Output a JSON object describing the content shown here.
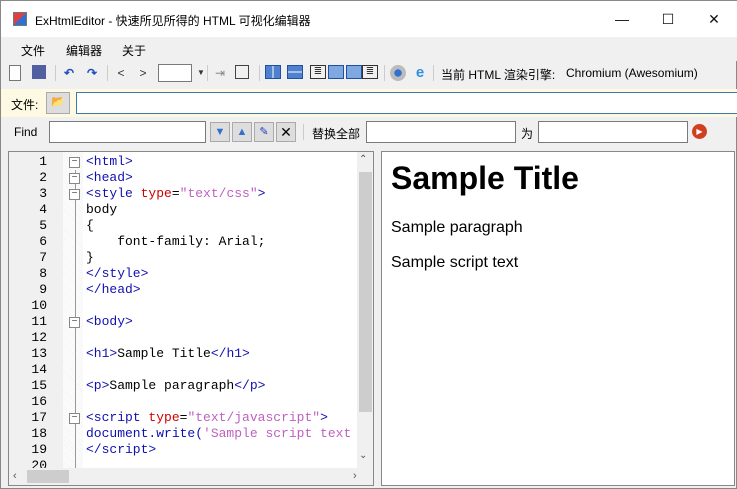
{
  "window": {
    "title": "ExHtmlEditor - 快速所见所得的 HTML 可视化编辑器",
    "minimize": "—",
    "maximize": "☐",
    "close": "✕"
  },
  "menu": [
    "文件",
    "编辑器",
    "关于"
  ],
  "toolbar": {
    "back": "<",
    "forward": ">",
    "zoom_value": "",
    "engine_label": "当前 HTML 渲染引擎:",
    "engine_value": "Chromium (Awesomium)"
  },
  "filebar": {
    "label": "文件:",
    "path": ""
  },
  "findbar": {
    "find_label": "Find",
    "find_value": "",
    "replace_all_label": "替换全部",
    "replace_from": "",
    "to_label": "为",
    "replace_to": ""
  },
  "editor": {
    "lines": [
      [
        [
          "t",
          "<html>"
        ]
      ],
      [
        [
          "t",
          "<head>"
        ]
      ],
      [
        [
          "t",
          "<style "
        ],
        [
          "a",
          "type"
        ],
        [
          "",
          "="
        ],
        [
          "s",
          "\"text/css\""
        ],
        [
          "t",
          ">"
        ]
      ],
      [
        [
          "",
          "body"
        ]
      ],
      [
        [
          "",
          "{"
        ]
      ],
      [
        [
          "",
          "    font-family: Arial;"
        ]
      ],
      [
        [
          "",
          "}"
        ]
      ],
      [
        [
          "t",
          "</style>"
        ]
      ],
      [
        [
          "t",
          "</head>"
        ]
      ],
      [],
      [
        [
          "t",
          "<body>"
        ]
      ],
      [],
      [
        [
          "t",
          "<h1>"
        ],
        [
          "",
          "Sample Title"
        ],
        [
          "t",
          "</h1>"
        ]
      ],
      [],
      [
        [
          "t",
          "<p>"
        ],
        [
          "",
          "Sample paragraph"
        ],
        [
          "t",
          "</p>"
        ]
      ],
      [],
      [
        [
          "t",
          "<script "
        ],
        [
          "a",
          "type"
        ],
        [
          "",
          "="
        ],
        [
          "s",
          "\"text/javascript\""
        ],
        [
          "t",
          ">"
        ]
      ],
      [
        [
          "t",
          "document.write("
        ],
        [
          "s",
          "'Sample script text"
        ]
      ],
      [
        [
          "t",
          "</script>"
        ]
      ],
      []
    ]
  },
  "preview": {
    "title": "Sample Title",
    "paragraph": "Sample paragraph",
    "script_text": "Sample script text"
  }
}
